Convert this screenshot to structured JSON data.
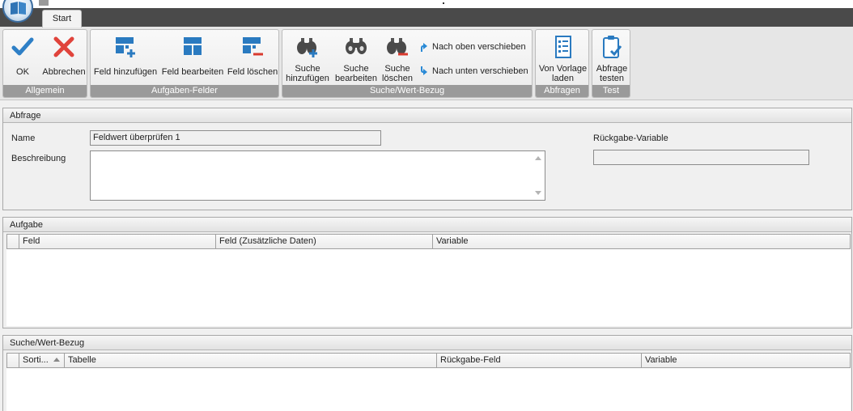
{
  "tabs": [
    "Start"
  ],
  "ribbon": {
    "groups": {
      "allgemein": "Allgemein",
      "aufgaben_felder": "Aufgaben-Felder",
      "suche": "Suche/Wert-Bezug",
      "abfragen": "Abfragen",
      "test": "Test"
    },
    "buttons": {
      "ok": "OK",
      "abbrechen": "Abbrechen",
      "feld_hinzufuegen": "Feld hinzufügen",
      "feld_bearbeiten": "Feld bearbeiten",
      "feld_loeschen": "Feld löschen",
      "suche_hinzufuegen_1": "Suche",
      "suche_hinzufuegen_2": "hinzufügen",
      "suche_bearbeiten_1": "Suche",
      "suche_bearbeiten_2": "bearbeiten",
      "suche_loeschen_1": "Suche",
      "suche_loeschen_2": "löschen",
      "nach_oben": "Nach oben verschieben",
      "nach_unten": "Nach unten verschieben",
      "von_vorlage_1": "Von Vorlage",
      "von_vorlage_2": "laden",
      "abfrage_testen_1": "Abfrage",
      "abfrage_testen_2": "testen"
    },
    "colors": {
      "ok": "#2e7fc6",
      "cancel": "#e0433b",
      "blue": "#2a7ac0",
      "red": "#d93a2e",
      "group_label_bg": "#9a9a9a"
    }
  },
  "abfrage": {
    "title": "Abfrage",
    "name_label": "Name",
    "name_value": "Feldwert überprüfen 1",
    "beschreibung_label": "Beschreibung",
    "beschreibung_value": "",
    "rueckgabe_label": "Rückgabe-Variable",
    "rueckgabe_value": ""
  },
  "aufgabe": {
    "title": "Aufgabe",
    "columns": [
      "Feld",
      "Feld (Zusätzliche Daten)",
      "Variable"
    ],
    "rows": []
  },
  "suche": {
    "title": "Suche/Wert-Bezug",
    "columns": [
      "Sorti...",
      "Tabelle",
      "Rückgabe-Feld",
      "Variable"
    ],
    "rows": []
  }
}
